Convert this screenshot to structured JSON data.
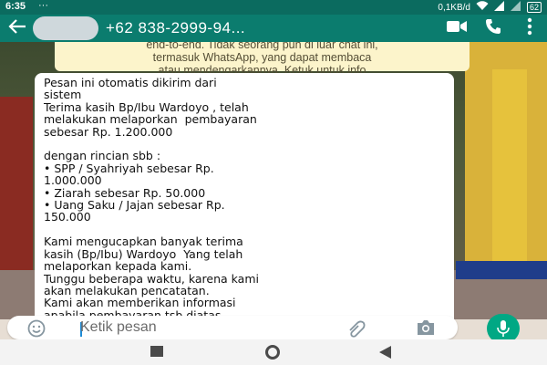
{
  "status_bar": {
    "time": "6:35",
    "dots": "···",
    "net_speed": "0,1KB/d",
    "battery": "62"
  },
  "header": {
    "contact": "+62 838-2999-94...",
    "icons": [
      "back-arrow-icon",
      "video-call-icon",
      "phone-icon",
      "more-vert-icon"
    ]
  },
  "encryption_notice": "end-to-end. Tidak seorang pun di luar chat ini,\ntermasuk WhatsApp, yang dapat membaca\natau mendengarkannya. Ketuk untuk info\nselengkapnya.",
  "message": {
    "text": "Pesan ini otomatis dikirim dari\nsistem\nTerima kasih Bp/Ibu Wardoyo , telah\nmelakukan melaporkan  pembayaran\nsebesar Rp. 1.200.000\n\ndengan rincian sbb :\n• SPP / Syahriyah sebesar Rp.\n1.000.000\n• Ziarah sebesar Rp. 50.000\n• Uang Saku / Jajan sebesar Rp.\n150.000\n\nKami mengucapkan banyak terima\nkasih (Bp/Ibu) Wardoyo  Yang telah\nmelaporkan kepada kami.\nTunggu beberapa waktu, karena kami\nakan melakukan pencatatan.\nKami akan memberikan informasi\napabila pembayaran tsb diatas\nsesuai.\n\nSemoga pekerjaan dan usahanya"
  },
  "input": {
    "placeholder": "Ketik pesan"
  },
  "colors": {
    "header": "#0b7c6e",
    "status_bar": "#0b6b5f",
    "mic_button": "#00a884",
    "notice_bg": "#fcf4cb"
  }
}
